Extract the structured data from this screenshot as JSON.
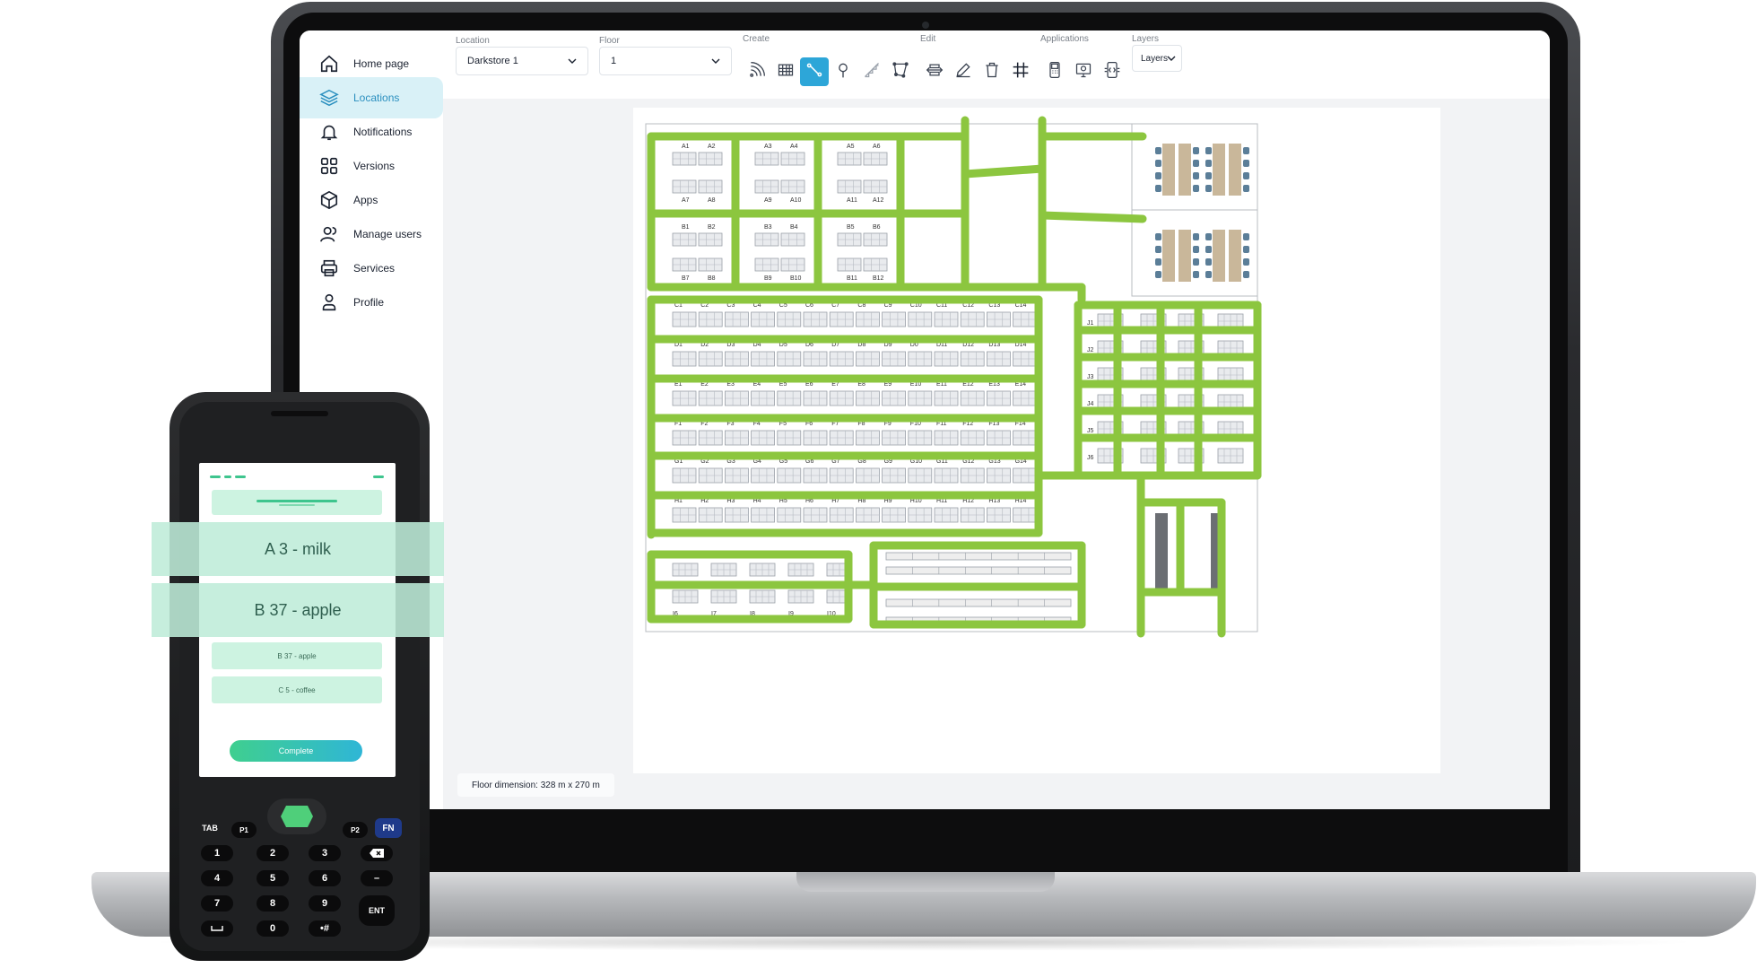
{
  "sidebar": {
    "items": [
      {
        "label": "Home page",
        "icon": "home-icon"
      },
      {
        "label": "Locations",
        "icon": "layers-icon",
        "active": true
      },
      {
        "label": "Notifications",
        "icon": "bell-icon"
      },
      {
        "label": "Versions",
        "icon": "grid-icon"
      },
      {
        "label": "Apps",
        "icon": "box-icon"
      },
      {
        "label": "Manage users",
        "icon": "users-icon"
      },
      {
        "label": "Services",
        "icon": "printer-icon"
      },
      {
        "label": "Profile",
        "icon": "profile-icon"
      }
    ]
  },
  "toolbar": {
    "location_label": "Location",
    "location_value": "Darkstore 1",
    "floor_label": "Floor",
    "floor_value": "1",
    "create_label": "Create",
    "edit_label": "Edit",
    "applications_label": "Applications",
    "layers_label": "Layers",
    "layers_value": "Layers"
  },
  "map": {
    "floor_dimension": "Floor dimension: 328 m x 270 m",
    "row_a_top": [
      "A1",
      "A2",
      "A3",
      "A4",
      "A5",
      "A6"
    ],
    "row_a_bottom": [
      "A7",
      "A8",
      "A9",
      "A10",
      "A11",
      "A12"
    ],
    "row_b_top": [
      "B1",
      "B2",
      "B3",
      "B4",
      "B5",
      "B6"
    ],
    "row_b_bottom": [
      "B7",
      "B8",
      "B9",
      "B10",
      "B11",
      "B12"
    ],
    "row_c": [
      "C1",
      "C2",
      "C3",
      "C4",
      "C5",
      "C6",
      "C7",
      "C8",
      "C9",
      "C10",
      "C11",
      "C12",
      "C13",
      "C14"
    ],
    "row_d": [
      "D1",
      "D2",
      "D3",
      "D4",
      "D5",
      "D6",
      "D7",
      "D8",
      "D9",
      "D0",
      "D11",
      "D12",
      "D13",
      "D14"
    ],
    "row_e": [
      "E1",
      "E2",
      "E3",
      "E4",
      "E5",
      "E6",
      "E7",
      "E8",
      "E9",
      "E10",
      "E11",
      "E12",
      "E13",
      "E14"
    ],
    "row_f": [
      "F1",
      "F2",
      "F3",
      "F4",
      "F5",
      "F6",
      "F7",
      "F8",
      "F9",
      "F10",
      "F11",
      "F12",
      "F13",
      "F14"
    ],
    "row_g": [
      "G1",
      "G2",
      "G3",
      "G4",
      "G5",
      "G6",
      "G7",
      "G8",
      "G9",
      "G10",
      "G11",
      "G12",
      "G13",
      "G14"
    ],
    "row_h": [
      "H1",
      "H2",
      "H3",
      "H4",
      "H5",
      "H6",
      "H7",
      "H8",
      "H9",
      "H10",
      "H11",
      "H12",
      "H13",
      "H14"
    ],
    "row_j": [
      "J1",
      "J2",
      "J3",
      "J4",
      "J5",
      "J6"
    ],
    "row_i_top": [
      "I1",
      "I2",
      "I3",
      "I4",
      "I5"
    ],
    "row_i_bottom": [
      "I6",
      "I7",
      "I8",
      "I9",
      "I10"
    ],
    "path_color": "#8cc63f"
  },
  "handheld": {
    "pick_1": "A 3 - milk",
    "pick_2": "B 37 - apple",
    "list_item_1": "B 37 - apple",
    "list_item_2": "C 5 - coffee",
    "complete_label": "Complete",
    "keys": {
      "tab": "TAB",
      "p1": "P1",
      "p2": "P2",
      "fn": "FN",
      "k1": "1",
      "k2": "2",
      "k3": "3",
      "k4": "4",
      "k5": "5",
      "k6": "6",
      "k7": "7",
      "k8": "8",
      "k9": "9",
      "k0": "0",
      "minus": "–",
      "hash": "•#",
      "ent": "ENT"
    }
  },
  "colors": {
    "accent": "#2da6d8",
    "active_nav_bg": "#d9f1f7",
    "path_green": "#8cc63f",
    "handheld_green": "#3ec58e"
  }
}
